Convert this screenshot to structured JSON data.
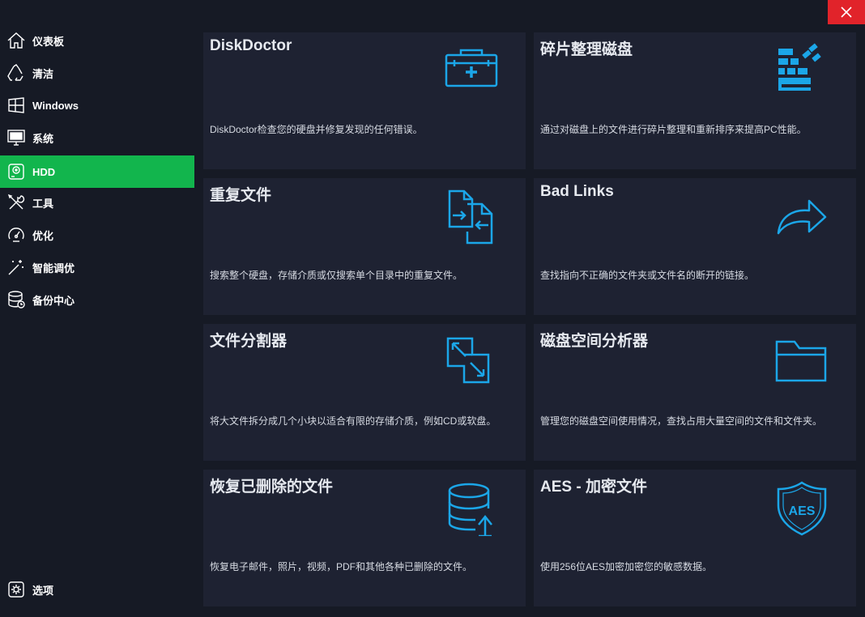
{
  "window": {
    "close_icon": "close-icon",
    "accent": "#12b54d",
    "icon_color": "#1ba6e8"
  },
  "sidebar": {
    "items": [
      {
        "label": "仪表板",
        "icon": "home-icon"
      },
      {
        "label": "清洁",
        "icon": "recycle-icon"
      },
      {
        "label": "Windows",
        "icon": "windows-icon"
      },
      {
        "label": "系统",
        "icon": "monitor-icon"
      },
      {
        "label": "HDD",
        "icon": "hdd-icon",
        "active": true
      },
      {
        "label": "工具",
        "icon": "tools-icon"
      },
      {
        "label": "优化",
        "icon": "speedometer-icon"
      },
      {
        "label": "智能调优",
        "icon": "magic-wand-icon"
      },
      {
        "label": "备份中心",
        "icon": "database-backup-icon"
      }
    ],
    "options": {
      "label": "选项",
      "icon": "settings-icon"
    }
  },
  "cards": [
    {
      "title": "DiskDoctor",
      "description": "DiskDoctor检查您的硬盘并修复发现的任何错误。",
      "icon": "toolbox-icon"
    },
    {
      "title": "碎片整理磁盘",
      "description": "通过对磁盘上的文件进行碎片整理和重新排序来提高PC性能。",
      "icon": "defrag-icon"
    },
    {
      "title": "重复文件",
      "description": "搜索整个硬盘，存储介质或仅搜索单个目录中的重复文件。",
      "icon": "duplicate-files-icon"
    },
    {
      "title": "Bad Links",
      "description": "查找指向不正确的文件夹或文件名的断开的链接。",
      "icon": "share-arrow-icon"
    },
    {
      "title": "文件分割器",
      "description": "将大文件拆分成几个小块以适合有限的存储介质，例如CD或软盘。",
      "icon": "file-split-icon"
    },
    {
      "title": "磁盘空间分析器",
      "description": "管理您的磁盘空间使用情况，查找占用大量空间的文件和文件夹。",
      "icon": "folder-icon"
    },
    {
      "title": "恢复已删除的文件",
      "description": "恢复电子邮件，照片，视频，PDF和其他各种已删除的文件。",
      "icon": "database-restore-icon"
    },
    {
      "title": "AES - 加密文件",
      "description": "使用256位AES加密加密您的敏感数据。",
      "icon": "aes-shield-icon",
      "badge": "AES"
    }
  ]
}
